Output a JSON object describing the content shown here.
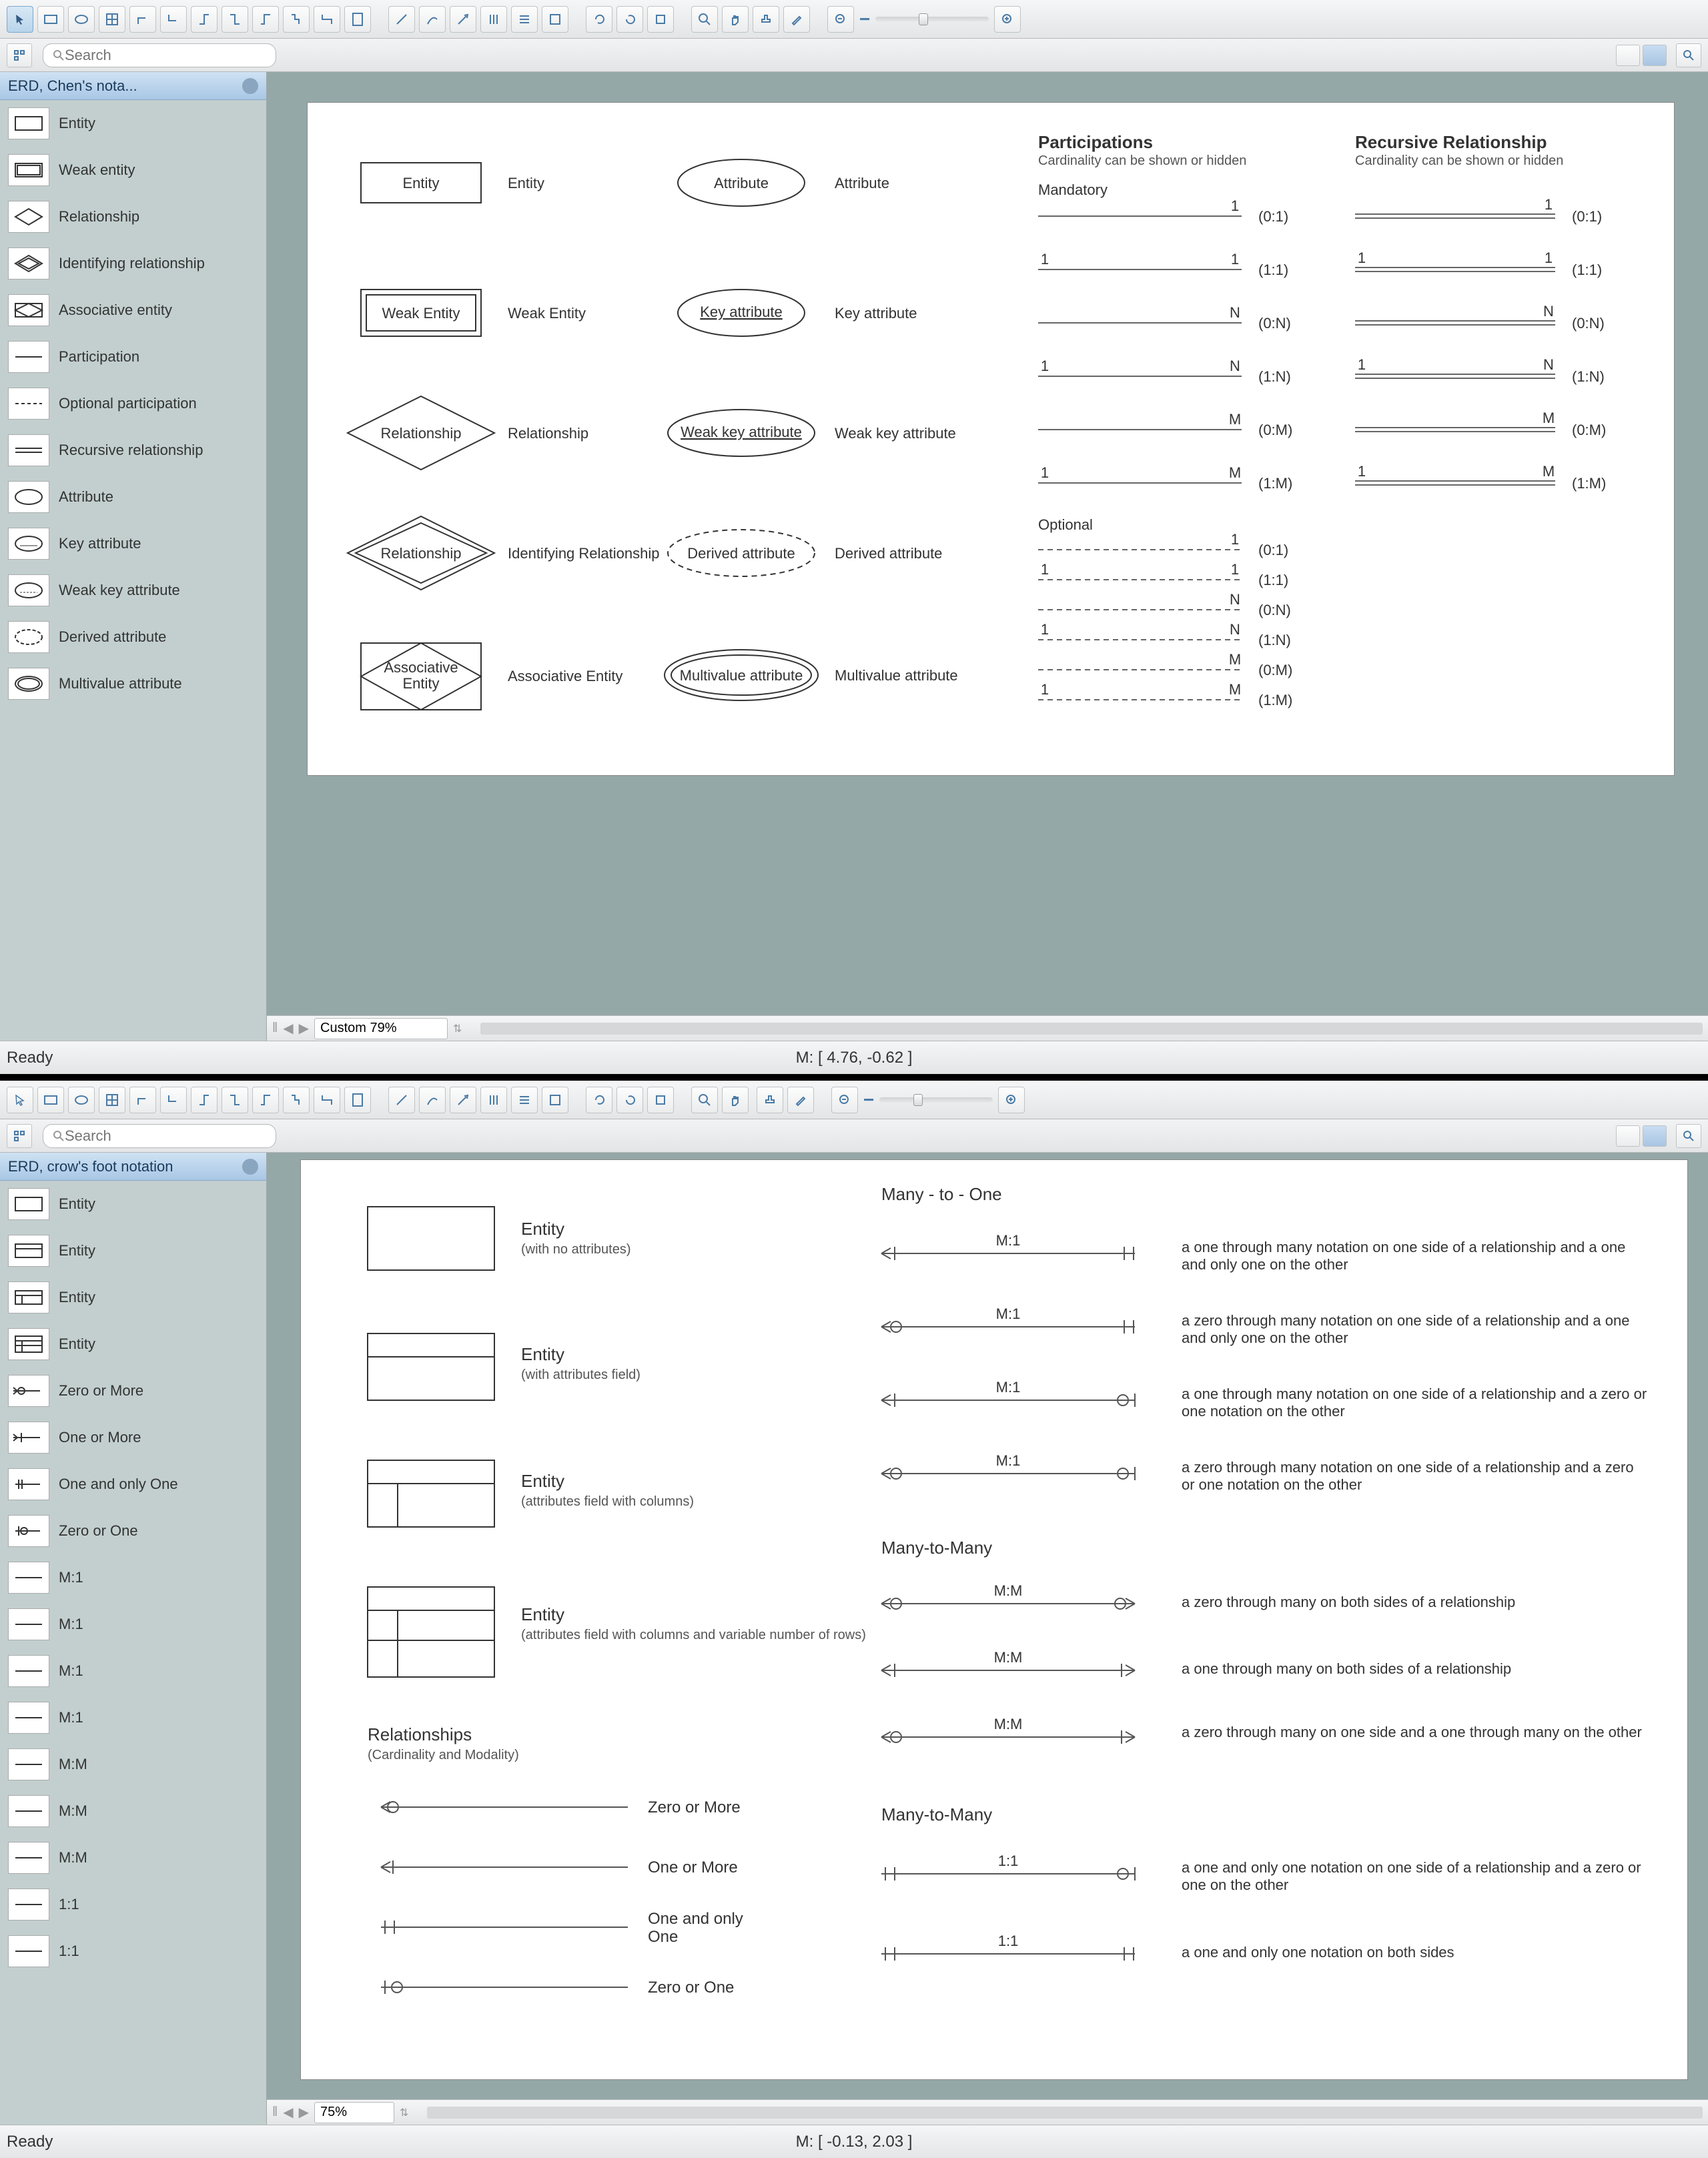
{
  "top": {
    "sidebar_title": "ERD, Chen's nota...",
    "search_placeholder": "Search",
    "zoom_label": "Custom 79%",
    "status_ready": "Ready",
    "status_coords": "M: [ 4.76, -0.62 ]",
    "side_items": [
      "Entity",
      "Weak entity",
      "Relationship",
      "Identifying relationship",
      "Associative entity",
      "Participation",
      "Optional participation",
      "Recursive relationship",
      "Attribute",
      "Key attribute",
      "Weak key attribute",
      "Derived attribute",
      "Multivalue attribute"
    ],
    "canvas": {
      "entities": {
        "entity_shape": "Entity",
        "entity_label": "Entity",
        "weak_entity_shape": "Weak Entity",
        "weak_entity_label": "Weak Entity",
        "relationship_shape": "Relationship",
        "relationship_label": "Relationship",
        "identifying_shape": "Relationship",
        "identifying_label": "Identifying Relationship",
        "associative_shape_l1": "Associative",
        "associative_shape_l2": "Entity",
        "associative_label": "Associative Entity",
        "attribute_shape": "Attribute",
        "attribute_label": "Attribute",
        "key_attribute_shape": "Key attribute",
        "key_attribute_label": "Key attribute",
        "weak_key_attribute_shape": "Weak key attribute",
        "weak_key_attribute_label": "Weak key attribute",
        "derived_attribute_shape": "Derived attribute",
        "derived_attribute_label": "Derived attribute",
        "multivalue_attribute_shape": "Multivalue attribute",
        "multivalue_attribute_label": "Multivalue attribute"
      },
      "participations_title": "Participations",
      "participations_sub": "Cardinality can be shown or hidden",
      "recursive_title": "Recursive Relationship",
      "recursive_sub": "Cardinality can be shown or hidden",
      "mandatory_label": "Mandatory",
      "optional_label": "Optional",
      "cardinalities": {
        "c01": "(0:1)",
        "c11": "(1:1)",
        "c0n": "(0:N)",
        "c1n": "(1:N)",
        "c0m": "(0:M)",
        "c1m": "(1:M)"
      },
      "digits": {
        "one": "1",
        "n": "N",
        "m": "M"
      }
    }
  },
  "bottom": {
    "sidebar_title": "ERD, crow's foot notation",
    "search_placeholder": "Search",
    "zoom_label": "75%",
    "status_ready": "Ready",
    "status_coords": "M: [ -0.13, 2.03 ]",
    "side_items": [
      "Entity",
      "Entity",
      "Entity",
      "Entity",
      "Zero or More",
      "One or More",
      "One and only One",
      "Zero or One",
      "M:1",
      "M:1",
      "M:1",
      "M:1",
      "M:M",
      "M:M",
      "M:M",
      "1:1",
      "1:1"
    ],
    "canvas": {
      "entity1_title": "Entity",
      "entity1_sub": "(with no attributes)",
      "entity2_title": "Entity",
      "entity2_sub": "(with attributes field)",
      "entity3_title": "Entity",
      "entity3_sub": "(attributes field with columns)",
      "entity4_title": "Entity",
      "entity4_sub": "(attributes field with columns and variable number of rows)",
      "rel_title": "Relationships",
      "rel_sub": "(Cardinality and Modality)",
      "basics": {
        "zero_or_more": "Zero or More",
        "one_or_more": "One or More",
        "one_and_only_one_l1": "One and only",
        "one_and_only_one_l2": "One",
        "zero_or_one": "Zero or One"
      },
      "mto_title": "Many - to - One",
      "mtm_title": "Many-to-Many",
      "oo_title": "Many-to-Many",
      "rel_labels": {
        "m1": "M:1",
        "mm": "M:M",
        "oo": "1:1"
      },
      "mto": [
        "a one through many notation on one side of a relationship and a one and only one on the other",
        "a zero through many notation on one side of a relationship and a one and only one on the other",
        "a one through many notation on one side of a relationship and a zero or one notation on the other",
        "a zero through many notation on one side of a relationship and a zero or one notation on the other"
      ],
      "mtm": [
        "a zero through many on both sides of a relationship",
        "a one through many on both sides of a relationship",
        "a zero through many on one side and a one through many on the other"
      ],
      "one": [
        "a one and only one notation on one side of a relationship and a zero or one on the other",
        "a one and only one notation on both sides"
      ]
    }
  }
}
